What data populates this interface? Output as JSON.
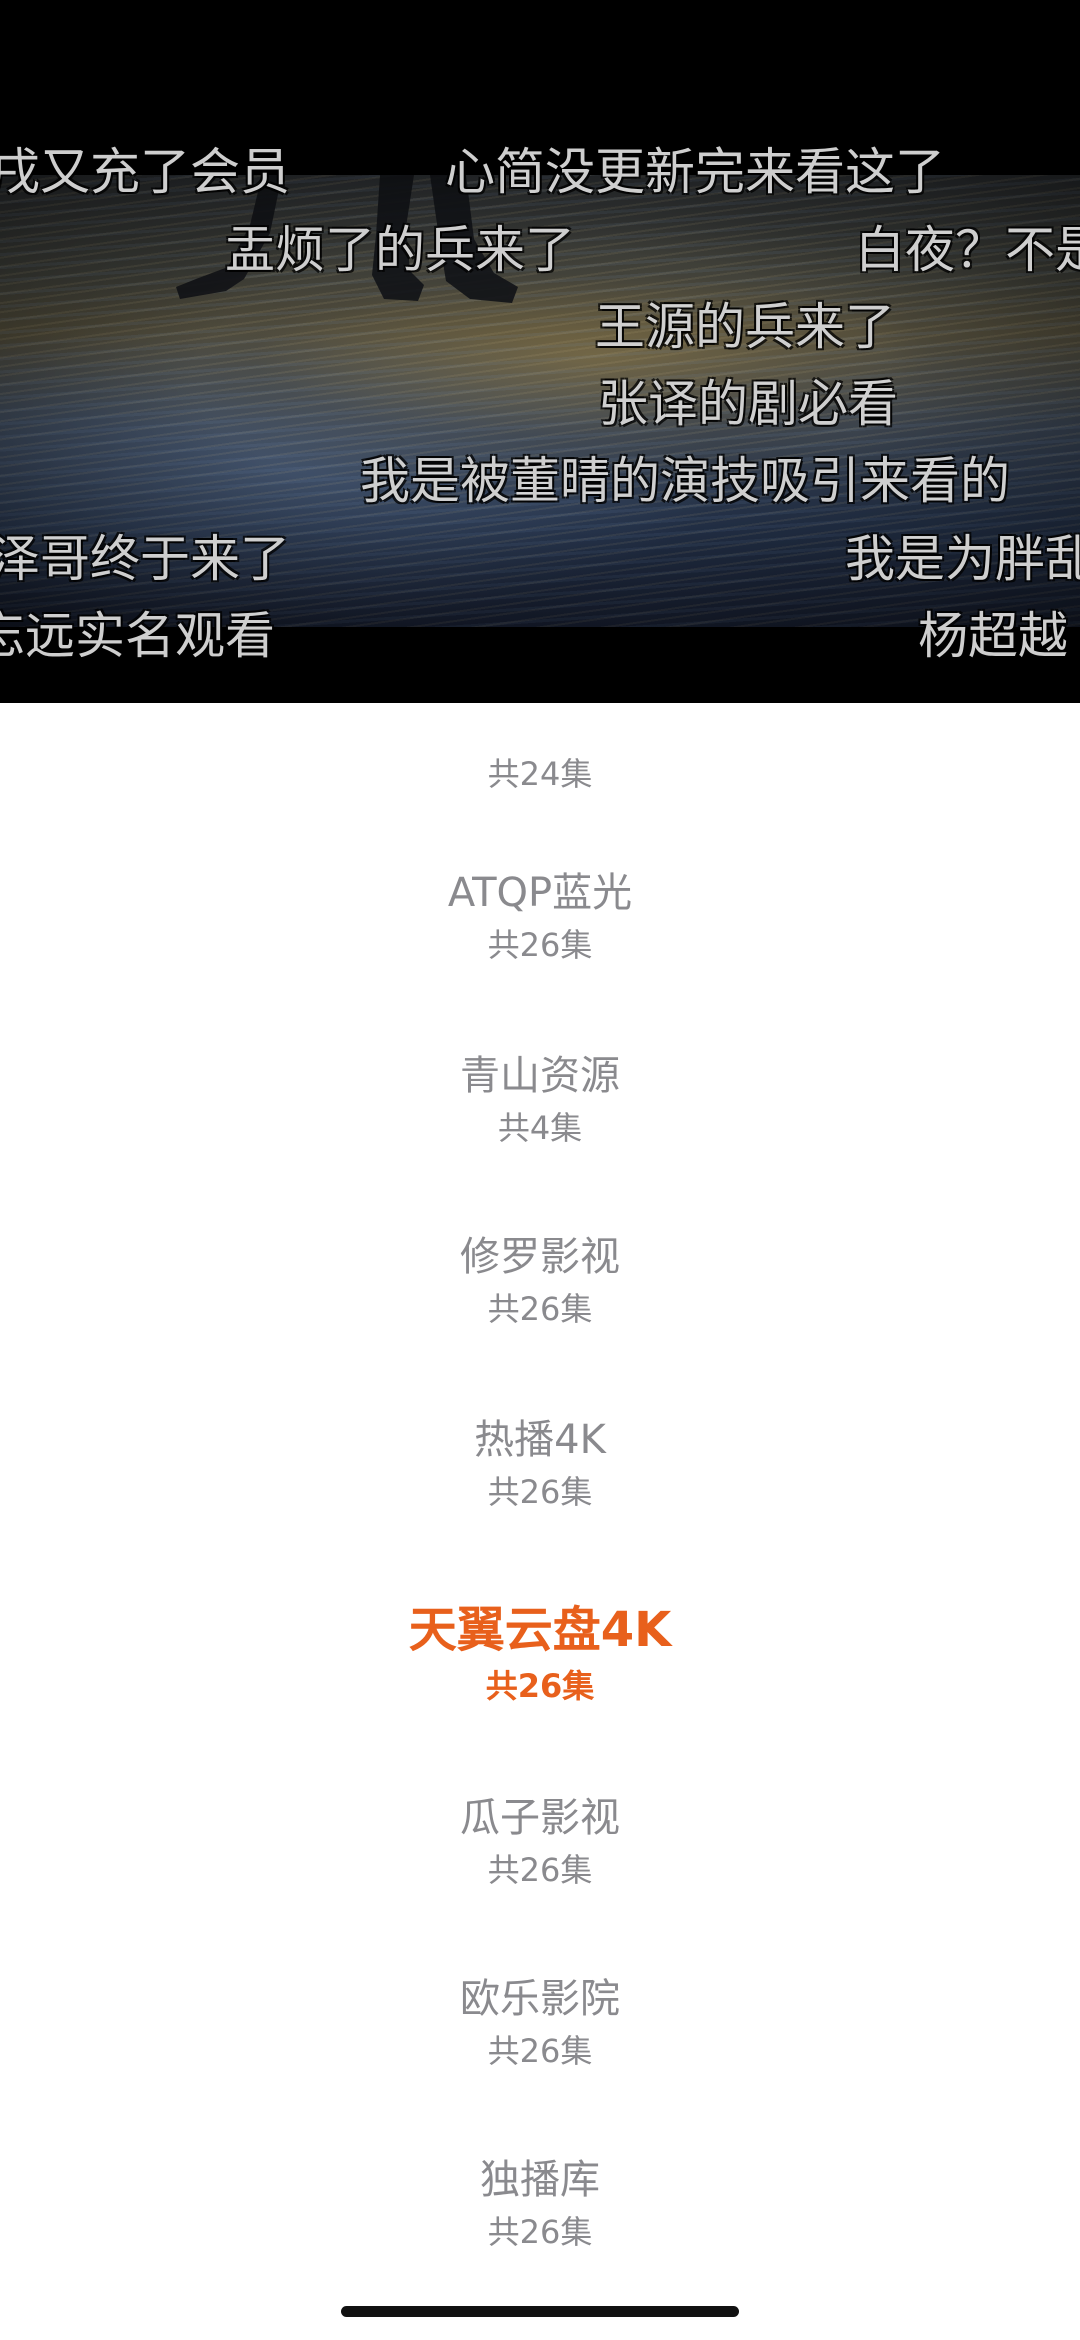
{
  "player": {
    "danmaku": [
      "戌又充了会员",
      "心简没更新完来看这了",
      "盂烦了的兵来了",
      "白夜？不是",
      "王源的兵来了",
      "张译的剧必看",
      "我是被董晴的演技吸引来看的",
      "泽哥终于来了",
      "我是为胖乱",
      "忘远实名观看",
      "杨超越"
    ]
  },
  "sources": [
    {
      "name": "",
      "count": "共24集"
    },
    {
      "name": "ATQP蓝光",
      "count": "共26集"
    },
    {
      "name": "青山资源",
      "count": "共4集"
    },
    {
      "name": "修罗影视",
      "count": "共26集"
    },
    {
      "name": "热播4K",
      "count": "共26集"
    },
    {
      "name": "天翼云盘4K",
      "count": "共26集",
      "selected": true
    },
    {
      "name": "瓜子影视",
      "count": "共26集"
    },
    {
      "name": "欧乐影院",
      "count": "共26集"
    },
    {
      "name": "独播库",
      "count": "共26集"
    }
  ],
  "colors": {
    "selected": "#e8601c",
    "unselected": "#8a8a8e",
    "danmaku": "#ebebeb"
  }
}
